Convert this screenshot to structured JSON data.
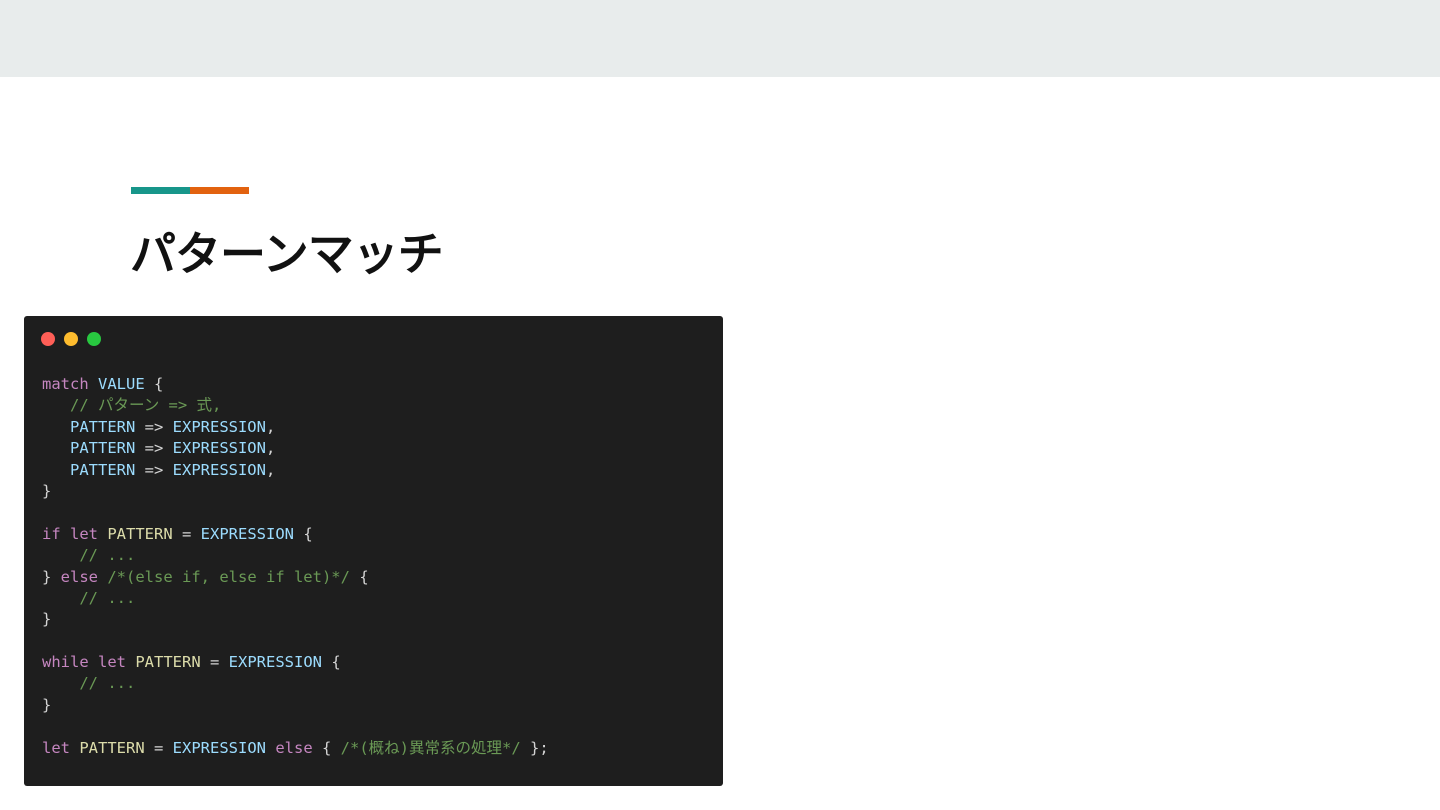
{
  "slide": {
    "title": "パターンマッチ"
  },
  "colors": {
    "accent_teal": "#17968a",
    "accent_orange": "#e2620f",
    "top_band": "#e8ecec",
    "code_bg": "#1e1e1e",
    "dot_red": "#ff5f57",
    "dot_yellow": "#febc2e",
    "dot_green": "#28c840"
  },
  "code": {
    "lines": [
      [
        [
          "kw",
          "match"
        ],
        [
          "pl",
          " "
        ],
        [
          "var",
          "VALUE"
        ],
        [
          "pl",
          " {"
        ]
      ],
      [
        [
          "pl",
          "   "
        ],
        [
          "cm",
          "// パターン => 式,"
        ]
      ],
      [
        [
          "pl",
          "   "
        ],
        [
          "var",
          "PATTERN"
        ],
        [
          "pl",
          " => "
        ],
        [
          "var",
          "EXPRESSION"
        ],
        [
          "pl",
          ","
        ]
      ],
      [
        [
          "pl",
          "   "
        ],
        [
          "var",
          "PATTERN"
        ],
        [
          "pl",
          " => "
        ],
        [
          "var",
          "EXPRESSION"
        ],
        [
          "pl",
          ","
        ]
      ],
      [
        [
          "pl",
          "   "
        ],
        [
          "var",
          "PATTERN"
        ],
        [
          "pl",
          " => "
        ],
        [
          "var",
          "EXPRESSION"
        ],
        [
          "pl",
          ","
        ]
      ],
      [
        [
          "pl",
          "}"
        ]
      ],
      [],
      [
        [
          "kw",
          "if let"
        ],
        [
          "pl",
          " "
        ],
        [
          "pat",
          "PATTERN"
        ],
        [
          "pl",
          " = "
        ],
        [
          "var",
          "EXPRESSION"
        ],
        [
          "pl",
          " {"
        ]
      ],
      [
        [
          "pl",
          "    "
        ],
        [
          "cm",
          "// ..."
        ]
      ],
      [
        [
          "pl",
          "} "
        ],
        [
          "kw",
          "else"
        ],
        [
          "pl",
          " "
        ],
        [
          "cm",
          "/*(else if, else if let)*/"
        ],
        [
          "pl",
          " {"
        ]
      ],
      [
        [
          "pl",
          "    "
        ],
        [
          "cm",
          "// ..."
        ]
      ],
      [
        [
          "pl",
          "}"
        ]
      ],
      [],
      [
        [
          "kw",
          "while let"
        ],
        [
          "pl",
          " "
        ],
        [
          "pat",
          "PATTERN"
        ],
        [
          "pl",
          " = "
        ],
        [
          "var",
          "EXPRESSION"
        ],
        [
          "pl",
          " {"
        ]
      ],
      [
        [
          "pl",
          "    "
        ],
        [
          "cm",
          "// ..."
        ]
      ],
      [
        [
          "pl",
          "}"
        ]
      ],
      [],
      [
        [
          "kw",
          "let"
        ],
        [
          "pl",
          " "
        ],
        [
          "pat",
          "PATTERN"
        ],
        [
          "pl",
          " = "
        ],
        [
          "var",
          "EXPRESSION"
        ],
        [
          "pl",
          " "
        ],
        [
          "kw",
          "else"
        ],
        [
          "pl",
          " { "
        ],
        [
          "cm",
          "/*(概ね)異常系の処理*/"
        ],
        [
          "pl",
          " };"
        ]
      ]
    ]
  }
}
